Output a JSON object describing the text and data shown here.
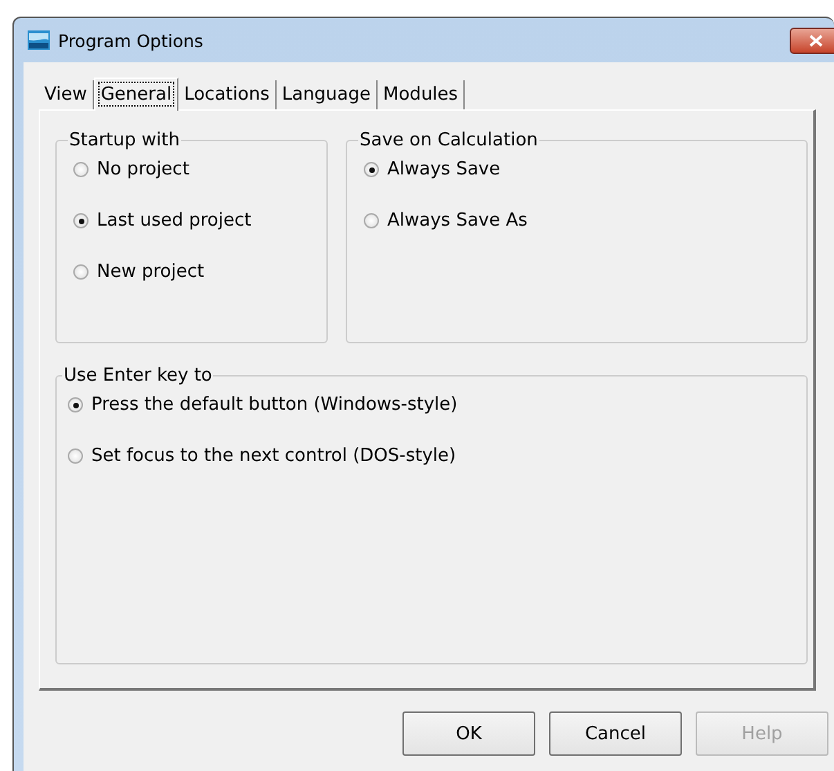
{
  "window": {
    "title": "Program Options"
  },
  "tabs": [
    {
      "label": "View",
      "selected": false
    },
    {
      "label": "General",
      "selected": true
    },
    {
      "label": "Locations",
      "selected": false
    },
    {
      "label": "Language",
      "selected": false
    },
    {
      "label": "Modules",
      "selected": false
    }
  ],
  "groups": [
    {
      "title": "Startup with",
      "options": [
        {
          "label": "No project",
          "selected": false
        },
        {
          "label": "Last used project",
          "selected": true
        },
        {
          "label": "New project",
          "selected": false
        }
      ]
    },
    {
      "title": "Save on Calculation",
      "options": [
        {
          "label": "Always Save",
          "selected": true
        },
        {
          "label": "Always Save As",
          "selected": false
        }
      ]
    },
    {
      "title": "Use Enter key to",
      "options": [
        {
          "label": "Press the default button (Windows-style)",
          "selected": true
        },
        {
          "label": "Set focus to the next control (DOS-style)",
          "selected": false
        }
      ]
    }
  ],
  "buttons": [
    {
      "label": "OK",
      "disabled": false
    },
    {
      "label": "Cancel",
      "disabled": false
    },
    {
      "label": "Help",
      "disabled": true
    }
  ]
}
